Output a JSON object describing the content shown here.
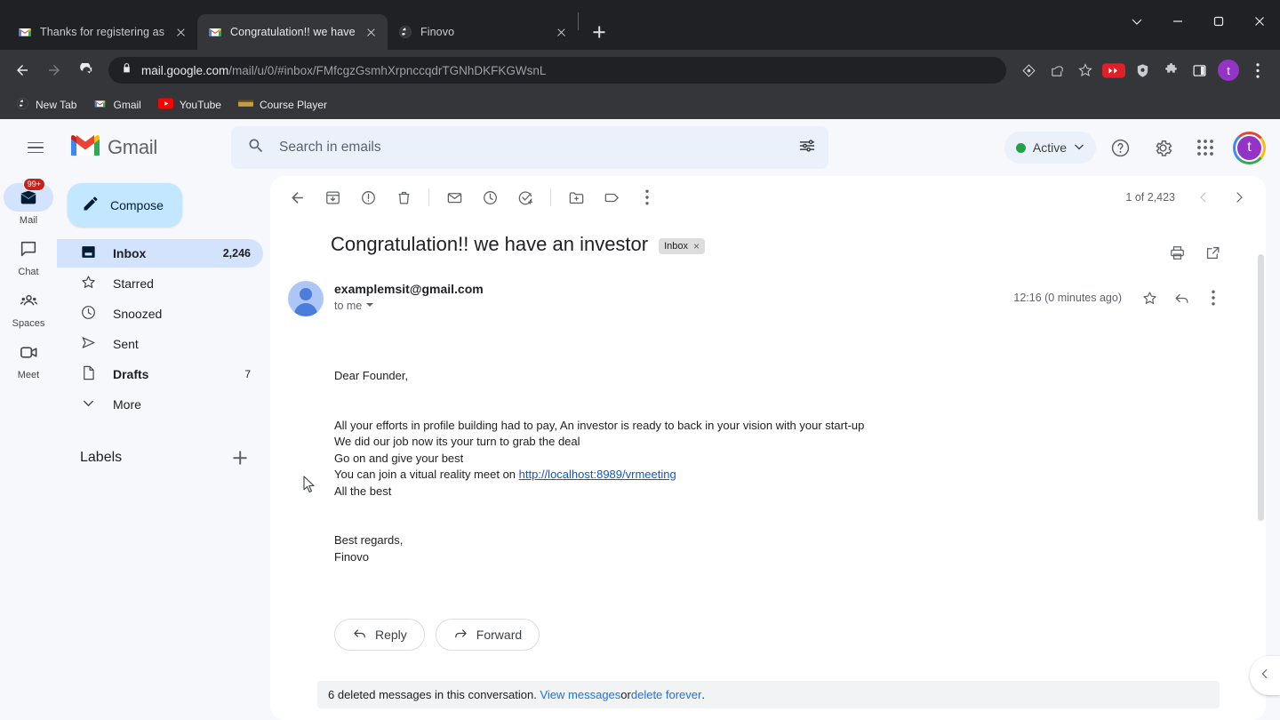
{
  "browser": {
    "tabs": [
      {
        "title": "Thanks for registering as an Inve",
        "favicon": "gmail-icon",
        "active": false
      },
      {
        "title": "Congratulation!! we have an inve",
        "favicon": "gmail-icon",
        "active": true
      },
      {
        "title": "Finovo",
        "favicon": "globe-icon",
        "active": false
      }
    ],
    "new_tab_label": "New tab",
    "window_controls": [
      "chevron-down",
      "minimize",
      "maximize",
      "close"
    ],
    "url_host": "mail.google.com",
    "url_path": "/mail/u/0/#inbox/FMfcgzGsmhXrpnccqdrTGNhDKFKGWsnL",
    "toolbar_icons": [
      "eye-diamond-icon",
      "share-icon",
      "star-icon",
      "fast-forward-badge-icon",
      "shield-icon",
      "puzzle-icon",
      "side-panel-icon",
      "more-vertical-icon"
    ],
    "profile_initial": "t",
    "bookmarks": [
      {
        "label": "New Tab",
        "icon": "globe-icon"
      },
      {
        "label": "Gmail",
        "icon": "gmail-icon"
      },
      {
        "label": "YouTube",
        "icon": "youtube-icon"
      },
      {
        "label": "Course Player",
        "icon": "course-icon"
      }
    ]
  },
  "gmail": {
    "app_name": "Gmail",
    "search": {
      "placeholder": "Search in emails",
      "value": "",
      "options_icon": "filter-options-icon"
    },
    "status": {
      "label": "Active",
      "color": "#1ea446"
    },
    "header_icons": [
      "help-icon",
      "settings-gear-icon",
      "apps-grid-icon"
    ],
    "account_initial": "t",
    "rail": [
      {
        "label": "Mail",
        "icon": "mail-icon",
        "badge": "99+",
        "active": true
      },
      {
        "label": "Chat",
        "icon": "chat-icon",
        "badge": "",
        "active": false
      },
      {
        "label": "Spaces",
        "icon": "spaces-icon",
        "badge": "",
        "active": false
      },
      {
        "label": "Meet",
        "icon": "meet-camera-icon",
        "badge": "",
        "active": false
      }
    ],
    "compose_label": "Compose",
    "nav_items": [
      {
        "label": "Inbox",
        "count": "2,246",
        "icon": "inbox-icon",
        "selected": true
      },
      {
        "label": "Starred",
        "count": "",
        "icon": "star-icon",
        "selected": false
      },
      {
        "label": "Snoozed",
        "count": "",
        "icon": "clock-icon",
        "selected": false
      },
      {
        "label": "Sent",
        "count": "",
        "icon": "send-icon",
        "selected": false
      },
      {
        "label": "Drafts",
        "count": "7",
        "icon": "draft-file-icon",
        "selected": false
      },
      {
        "label": "More",
        "count": "",
        "icon": "chevron-down-icon",
        "selected": false
      }
    ],
    "labels_title": "Labels",
    "toolbar_icons": [
      "back-arrow-icon",
      "archive-icon",
      "report-spam-icon",
      "delete-icon",
      "mark-unread-icon",
      "snooze-icon",
      "add-to-tasks-icon",
      "move-to-folder-icon",
      "labels-tag-icon",
      "more-vertical-icon"
    ],
    "pager_text": "1 of 2,423"
  },
  "email": {
    "subject": "Congratulation!! we have an investor",
    "label_chip": "Inbox",
    "label_chip_close": "×",
    "sender": "examplemsit@gmail.com",
    "recipient": "to me",
    "time": "12:16 (0 minutes ago)",
    "body": {
      "greeting": "Dear Founder,",
      "line1": "All your efforts in profile building had to pay, An investor is ready to back in your vision with your start-up",
      "line2": "We did our job now its your turn to grab the deal",
      "line3": "Go on and give your best",
      "line4_prefix": "You can join a vitual reality meet on ",
      "link_text": "http://localhost:8989/vrmeeting",
      "line5": "All the best",
      "signoff": "Best regards,",
      "signature": "Finovo"
    },
    "reply_label": "Reply",
    "forward_label": "Forward",
    "deleted_notice": {
      "prefix": "6 deleted messages in this conversation.",
      "view_link": "View messages",
      "middle": " or ",
      "delete_link": "delete forever",
      "suffix": "."
    }
  }
}
